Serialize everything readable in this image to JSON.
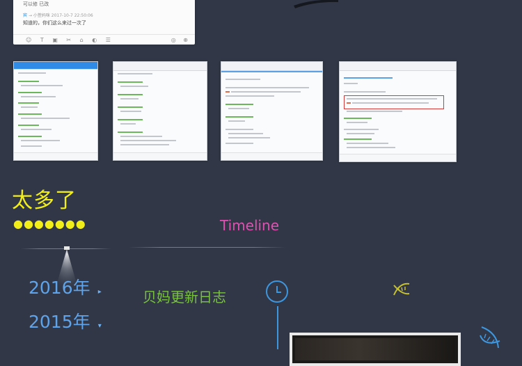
{
  "chat_card": {
    "line1": "可以修 已改",
    "sender": "宾",
    "meta": "→ 小萱妈咪 2017-10-7 22:50:06",
    "line2": "知道的，你们这么来过一次了"
  },
  "thumbnails": [
    {
      "style": "blue-header",
      "has_red_box": false
    },
    {
      "style": "gray-header",
      "has_red_box": false
    },
    {
      "style": "gray-header",
      "has_red_box": false
    },
    {
      "style": "gray-header",
      "has_red_box": true
    }
  ],
  "headline": "太多了",
  "dots": "●●●●●●●",
  "timeline_label": "Timeline",
  "years": [
    {
      "label": "2016年",
      "arrow": "▸"
    },
    {
      "label": "2015年",
      "arrow": "▾"
    }
  ],
  "log_title": "贝妈更新日志",
  "colors": {
    "background": "#313746",
    "headline": "#f2ee1a",
    "timeline": "#dd52b0",
    "year": "#5fa4ea",
    "log": "#79c141",
    "accent_line": "#3d97e0"
  },
  "icons": [
    "clock-icon",
    "dna-icon-yellow",
    "dna-icon-blue",
    "lamp-glow-icon"
  ]
}
